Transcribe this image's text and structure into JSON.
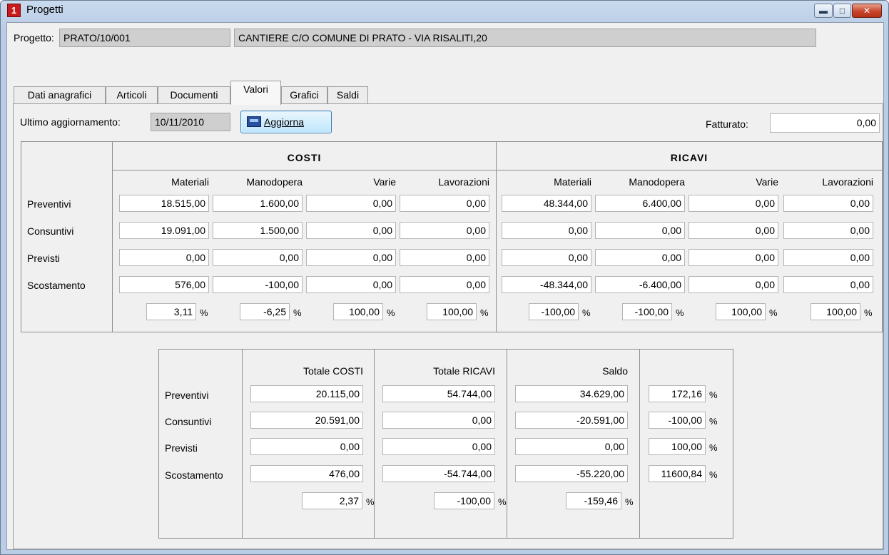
{
  "window": {
    "title": "Progetti",
    "app_icon_text": "1"
  },
  "project": {
    "label": "Progetto:",
    "code": "PRATO/10/001",
    "description": "CANTIERE C/O COMUNE DI PRATO - VIA RISALITI,20"
  },
  "tabs": [
    {
      "label": "Dati anagrafici"
    },
    {
      "label": "Articoli"
    },
    {
      "label": "Documenti"
    },
    {
      "label": "Valori"
    },
    {
      "label": "Grafici"
    },
    {
      "label": "Saldi"
    }
  ],
  "valori": {
    "ultimo_label": "Ultimo aggiornamento:",
    "ultimo_value": "10/11/2010",
    "aggiorna_label": "Aggiorna",
    "fatturato_label": "Fatturato:",
    "fatturato_value": "0,00",
    "percent_sign": "%",
    "costi_title": "COSTI",
    "ricavi_title": "RICAVI",
    "columns": [
      "Materiali",
      "Manodopera",
      "Varie",
      "Lavorazioni"
    ],
    "row_labels": [
      "Preventivi",
      "Consuntivi",
      "Previsti",
      "Scostamento"
    ],
    "costi": {
      "preventivi": [
        "18.515,00",
        "1.600,00",
        "0,00",
        "0,00"
      ],
      "consuntivi": [
        "19.091,00",
        "1.500,00",
        "0,00",
        "0,00"
      ],
      "previsti": [
        "0,00",
        "0,00",
        "0,00",
        "0,00"
      ],
      "scostamento": [
        "576,00",
        "-100,00",
        "0,00",
        "0,00"
      ],
      "percent": [
        "3,11",
        "-6,25",
        "100,00",
        "100,00"
      ]
    },
    "ricavi": {
      "preventivi": [
        "48.344,00",
        "6.400,00",
        "0,00",
        "0,00"
      ],
      "consuntivi": [
        "0,00",
        "0,00",
        "0,00",
        "0,00"
      ],
      "previsti": [
        "0,00",
        "0,00",
        "0,00",
        "0,00"
      ],
      "scostamento": [
        "-48.344,00",
        "-6.400,00",
        "0,00",
        "0,00"
      ],
      "percent": [
        "-100,00",
        "-100,00",
        "100,00",
        "100,00"
      ]
    },
    "totali": {
      "headers": [
        "Totale COSTI",
        "Totale RICAVI",
        "Saldo"
      ],
      "rows": [
        {
          "label": "Preventivi",
          "costi": "20.115,00",
          "ricavi": "54.744,00",
          "saldo": "34.629,00",
          "pct": "172,16"
        },
        {
          "label": "Consuntivi",
          "costi": "20.591,00",
          "ricavi": "0,00",
          "saldo": "-20.591,00",
          "pct": "-100,00"
        },
        {
          "label": "Previsti",
          "costi": "0,00",
          "ricavi": "0,00",
          "saldo": "0,00",
          "pct": "100,00"
        },
        {
          "label": "Scostamento",
          "costi": "476,00",
          "ricavi": "-54.744,00",
          "saldo": "-55.220,00",
          "pct": "11600,84"
        }
      ],
      "percent": [
        "2,37",
        "-100,00",
        "-159,46"
      ]
    }
  }
}
